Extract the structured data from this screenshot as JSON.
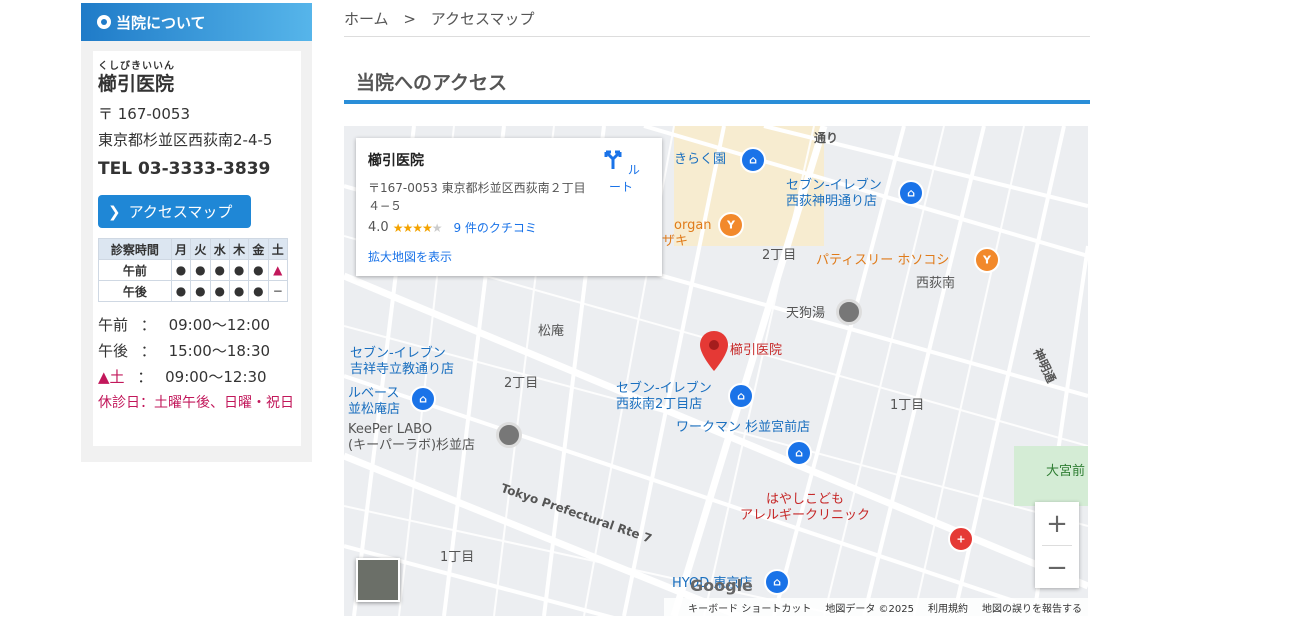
{
  "sidebar": {
    "header": "当院について",
    "ruby": "くしびきいいん",
    "clinic_name": "櫛引医院",
    "postal": "〒 167-0053",
    "address": "東京都杉並区西荻南2-4-5",
    "tel": "TEL 03-3333-3839",
    "access_button": "アクセスマップ",
    "hours_table": {
      "headers": [
        "診察時間",
        "月",
        "火",
        "水",
        "木",
        "金",
        "土"
      ],
      "rows": [
        {
          "label": "午前",
          "cells": [
            "●",
            "●",
            "●",
            "●",
            "●",
            "▲"
          ]
        },
        {
          "label": "午後",
          "cells": [
            "●",
            "●",
            "●",
            "●",
            "●",
            "−"
          ]
        }
      ]
    },
    "times": [
      {
        "label": "午前",
        "sep": "：",
        "value": "09:00〜12:00"
      },
      {
        "label": "午後",
        "sep": "：",
        "value": "15:00〜18:30"
      },
      {
        "label": "▲土",
        "sep": "：",
        "value": "09:00〜12:30"
      }
    ],
    "closed": "休診日：土曜午後、日曜・祝日"
  },
  "breadcrumb": {
    "home": "ホーム",
    "sep": ">",
    "current": "アクセスマップ"
  },
  "page_title": "当院へのアクセス",
  "map": {
    "info": {
      "name": "櫛引医院",
      "address": "〒167-0053 東京都杉並区西荻南２丁目４−５",
      "rating": "4.0",
      "reviews": "9 件のクチコミ",
      "enlarge": "拡大地図を表示",
      "route": "ルート"
    },
    "labels": {
      "kiraku": "きらく園",
      "seven_nishiogi": "セブン-イレブン\n西荻神明通り店",
      "organ": "organ",
      "zaki": "ザキ",
      "chome2_top": "2丁目",
      "patisserie": "パティスリー ホソコシ",
      "nishiogiminami": "西荻南",
      "tenguyu": "天狗湯",
      "shoan": "松庵",
      "marker_label": "櫛引医院",
      "seven_kichijoji": "セブン-イレブン\n吉祥寺立教通り店",
      "chome2_left": "2丁目",
      "seven_nishiogi2": "セブン-イレブン\n西荻南2丁目店",
      "chome1_right": "1丁目",
      "ruberse": "ルベース\n並松庵店",
      "keeper": "KeePer LABO\n(キーパーラボ)杉並店",
      "workman": "ワークマン 杉並宮前店",
      "rte7": "Tokyo Prefectural Rte 7",
      "shinmei": "神明通",
      "omiya": "大宮前",
      "hayashi": "はやしこども\nアレルギークリニック",
      "chome1_bottom": "1丁目",
      "hyod": "HYOD 東京店",
      "dori": "通り"
    },
    "google": "Google",
    "attrib": [
      "キーボード ショートカット",
      "地図データ ©2025",
      "利用規約",
      "地図の誤りを報告する"
    ]
  }
}
